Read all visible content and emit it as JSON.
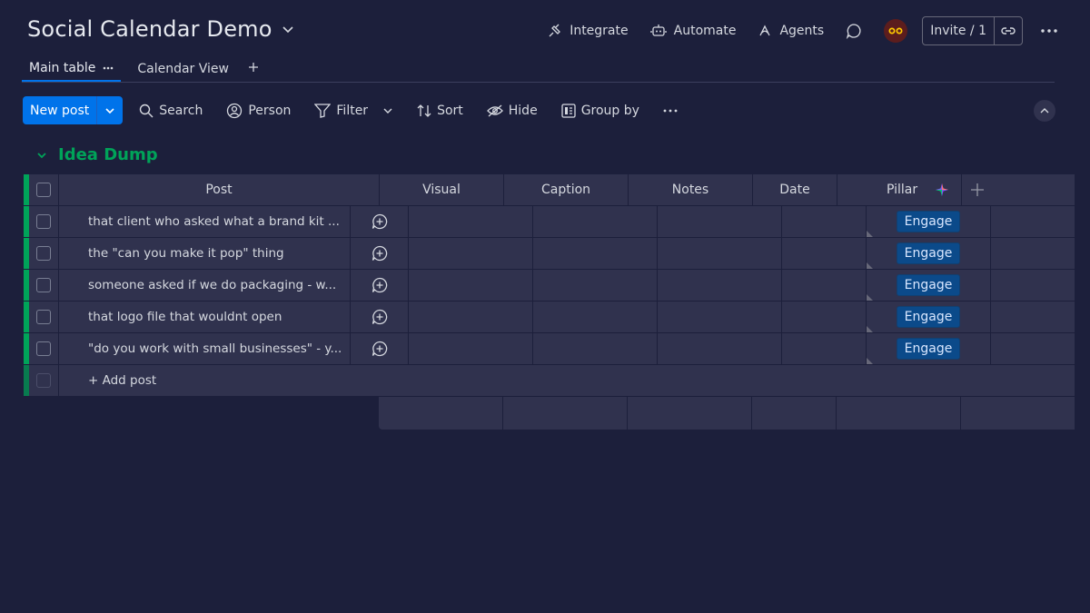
{
  "board": {
    "title": "Social Calendar Demo"
  },
  "header": {
    "integrate": "Integrate",
    "automate": "Automate",
    "agents": "Agents",
    "invite": "Invite / 1"
  },
  "tabs": [
    {
      "label": "Main table",
      "active": true
    },
    {
      "label": "Calendar View",
      "active": false
    }
  ],
  "toolbar": {
    "new_post": "New post",
    "search": "Search",
    "person": "Person",
    "filter": "Filter",
    "sort": "Sort",
    "hide": "Hide",
    "group_by": "Group by"
  },
  "group": {
    "title": "Idea Dump",
    "color": "#00a359"
  },
  "table": {
    "columns": [
      "Post",
      "Visual",
      "Caption",
      "Notes",
      "Date",
      "Pillar"
    ],
    "rows": [
      {
        "post": "that client who asked what a brand kit ...",
        "pillar": "Engage"
      },
      {
        "post": "the \"can you make it pop\" thing",
        "pillar": "Engage"
      },
      {
        "post": "someone asked if we do packaging - w...",
        "pillar": "Engage"
      },
      {
        "post": "that logo file that wouldnt open",
        "pillar": "Engage"
      },
      {
        "post": "\"do you work with small businesses\" - y...",
        "pillar": "Engage"
      }
    ],
    "add_post": "+ Add post"
  },
  "colors": {
    "accent": "#0073ea",
    "background": "#1c1f3b",
    "surface": "#30324e",
    "pillar_badge": "#0b4a8a"
  }
}
